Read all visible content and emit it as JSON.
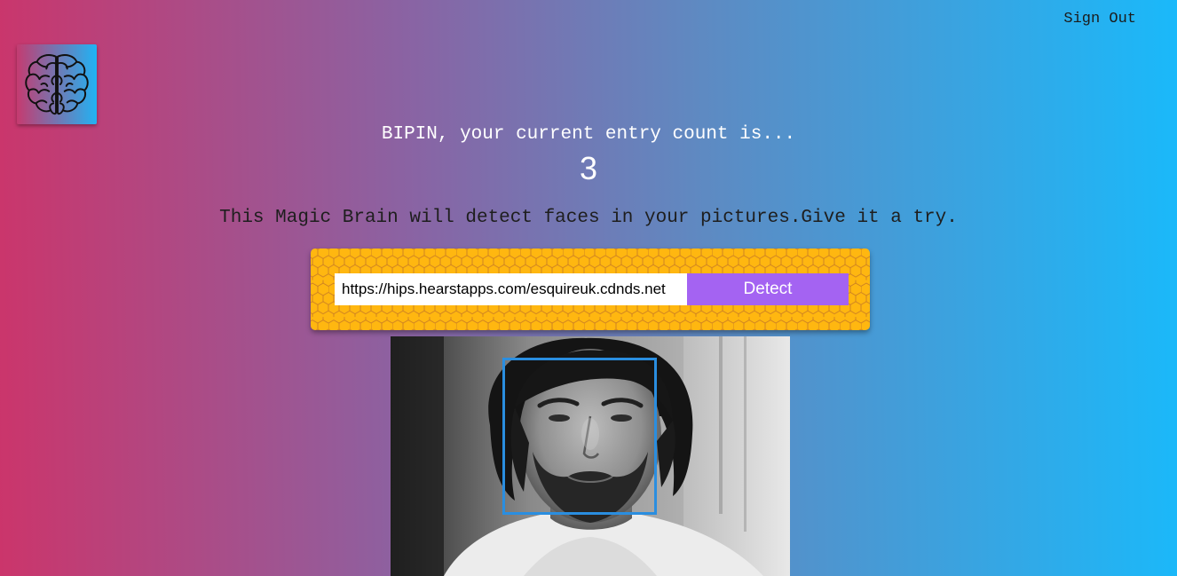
{
  "nav": {
    "sign_out": "Sign Out"
  },
  "logo": {
    "icon": "brain-icon"
  },
  "rank": {
    "message": "BIPIN, your current entry count is...",
    "count": "3"
  },
  "tagline": "This Magic Brain will detect faces in your pictures.Give it a try.",
  "form": {
    "url_value": "https://hips.hearstapps.com/esquireuk.cdnds.net",
    "button_label": "Detect"
  },
  "face_detection": {
    "image": "grayscale-portrait-photo",
    "box_color": "#2a8ee0",
    "faces_detected": 1
  },
  "colors": {
    "gradient_start": "#cb356b",
    "gradient_end": "#1ab9fa",
    "form_background": "#ffb710",
    "button": "#a463f2"
  }
}
